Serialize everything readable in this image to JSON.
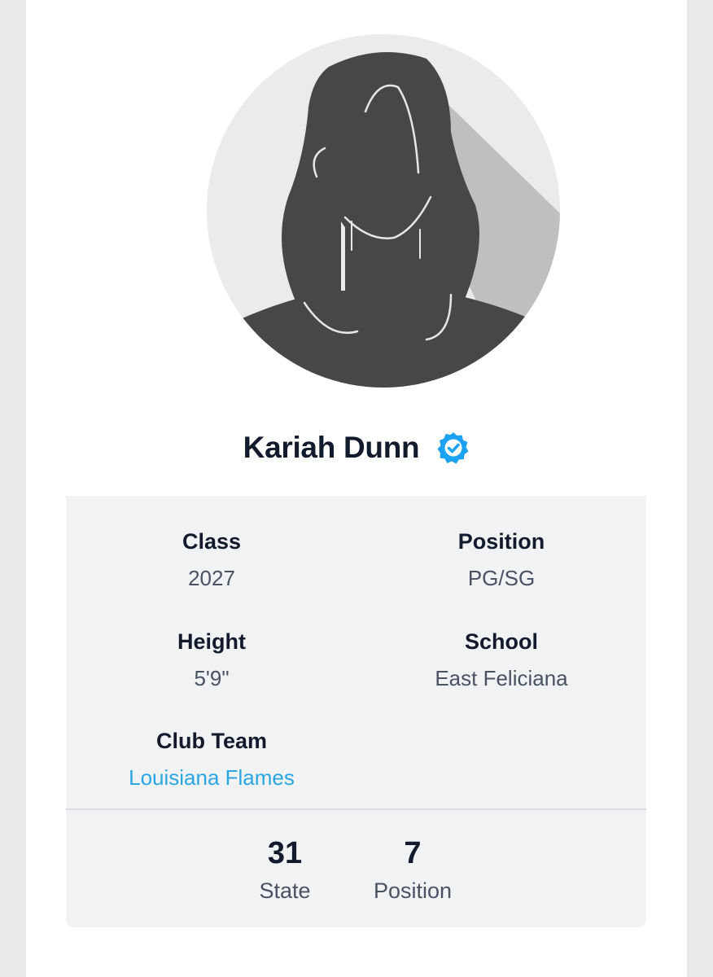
{
  "player": {
    "name": "Kariah Dunn",
    "verified": true,
    "avatar_icon": "silhouette-avatar-icon",
    "verified_icon": "verified-badge-icon"
  },
  "details": {
    "class_label": "Class",
    "class_value": "2027",
    "position_label": "Position",
    "position_value": "PG/SG",
    "height_label": "Height",
    "height_value": "5'9\"",
    "school_label": "School",
    "school_value": "East Feliciana",
    "club_label": "Club Team",
    "club_value": "Louisiana Flames"
  },
  "rankings": {
    "state_value": "31",
    "state_label": "State",
    "position_value": "7",
    "position_label": "Position"
  },
  "colors": {
    "accent": "#2aa6e0",
    "verified_badge": "#1da1f2",
    "text_dark": "#121a2b",
    "text_muted": "#4a5262",
    "panel_bg": "#f1f2f4"
  }
}
